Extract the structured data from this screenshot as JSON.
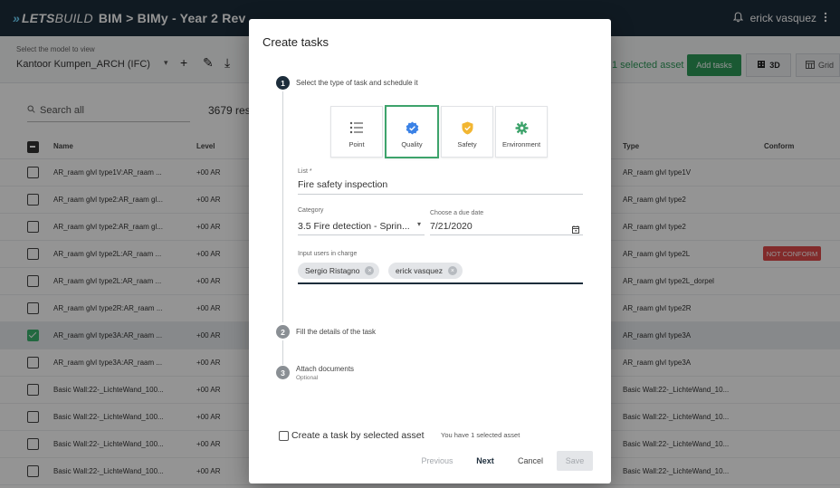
{
  "header": {
    "logo_arrows": "»",
    "logo_lets": "LETS",
    "logo_build": "BUILD",
    "breadcrumb": "BIM > BIMy - Year 2 Rev",
    "user_name": "erick vasquez",
    "bell_icon": "bell-icon",
    "menu_icon": "more-vert-icon"
  },
  "model": {
    "label": "Select the model to view",
    "value": "Kantoor Kumpen_ARCH (IFC)",
    "tools": [
      "+",
      "✎",
      "⤓"
    ],
    "selected_count": "1 selected asset",
    "add_tasks": "Add tasks",
    "view_3d": "3D",
    "view_grid": "Grid"
  },
  "search": {
    "placeholder": "Search all",
    "results": "3679 res"
  },
  "table": {
    "columns": {
      "name": "Name",
      "level": "Level",
      "type": "Type",
      "conform": "Conform"
    },
    "rows": [
      {
        "name": "AR_raam glvl type1V:AR_raam ...",
        "level": "+00 AR",
        "type": "AR_raam glvl type1V",
        "checked": false,
        "conform": ""
      },
      {
        "name": "AR_raam glvl type2:AR_raam gl...",
        "level": "+00 AR",
        "type": "AR_raam glvl type2",
        "checked": false,
        "conform": ""
      },
      {
        "name": "AR_raam glvl type2:AR_raam gl...",
        "level": "+00 AR",
        "type": "AR_raam glvl type2",
        "checked": false,
        "conform": ""
      },
      {
        "name": "AR_raam glvl type2L:AR_raam ...",
        "level": "+00 AR",
        "type": "AR_raam glvl type2L",
        "checked": false,
        "conform": "NOT CONFORM"
      },
      {
        "name": "AR_raam glvl type2L:AR_raam ...",
        "level": "+00 AR",
        "type": "AR_raam glvl type2L_dorpel",
        "checked": false,
        "conform": ""
      },
      {
        "name": "AR_raam glvl type2R:AR_raam ...",
        "level": "+00 AR",
        "type": "AR_raam glvl type2R",
        "checked": false,
        "conform": ""
      },
      {
        "name": "AR_raam glvl type3A:AR_raam ...",
        "level": "+00 AR",
        "type": "AR_raam glvl type3A",
        "checked": true,
        "conform": ""
      },
      {
        "name": "AR_raam glvl type3A:AR_raam ...",
        "level": "+00 AR",
        "type": "AR_raam glvl type3A",
        "checked": false,
        "conform": ""
      },
      {
        "name": "Basic Wall:22-_LichteWand_100...",
        "level": "+00 AR",
        "type": "Basic Wall:22-_LichteWand_10...",
        "checked": false,
        "conform": ""
      },
      {
        "name": "Basic Wall:22-_LichteWand_100...",
        "level": "+00 AR",
        "type": "Basic Wall:22-_LichteWand_10...",
        "checked": false,
        "conform": ""
      },
      {
        "name": "Basic Wall:22-_LichteWand_100...",
        "level": "+00 AR",
        "type": "Basic Wall:22-_LichteWand_10...",
        "checked": false,
        "conform": ""
      },
      {
        "name": "Basic Wall:22-_LichteWand_100...",
        "level": "+00 AR",
        "type": "Basic Wall:22-_LichteWand_10...",
        "checked": false,
        "conform": ""
      }
    ]
  },
  "modal": {
    "title": "Create tasks",
    "step1": {
      "num": "1",
      "label": "Select the type of task and schedule it"
    },
    "task_types": [
      {
        "label": "Point",
        "icon": "list-icon",
        "selected": false
      },
      {
        "label": "Quality",
        "icon": "verified-badge-icon",
        "selected": true
      },
      {
        "label": "Safety",
        "icon": "shield-icon",
        "selected": false
      },
      {
        "label": "Environment",
        "icon": "gear-icon",
        "selected": false
      }
    ],
    "list": {
      "label": "List *",
      "value": "Fire safety inspection"
    },
    "category": {
      "label": "Category",
      "value": "3.5 Fire detection - Sprin..."
    },
    "due": {
      "label": "Choose a due date",
      "value": "7/21/2020"
    },
    "users": {
      "label": "Input users in charge",
      "chips": [
        "Sergio Ristagno",
        "erick vasquez"
      ]
    },
    "step2": {
      "num": "2",
      "label": "Fill the details of the task"
    },
    "step3": {
      "num": "3",
      "label": "Attach documents",
      "sub": "Optional"
    },
    "footer": {
      "checkbox_label": "Create a task by selected asset",
      "note": "You have 1 selected asset",
      "previous": "Previous",
      "next": "Next",
      "cancel": "Cancel",
      "save": "Save"
    }
  },
  "colors": {
    "accent": "#2e9a59",
    "topbar": "#1d2d3b",
    "danger": "#e04a4a"
  }
}
